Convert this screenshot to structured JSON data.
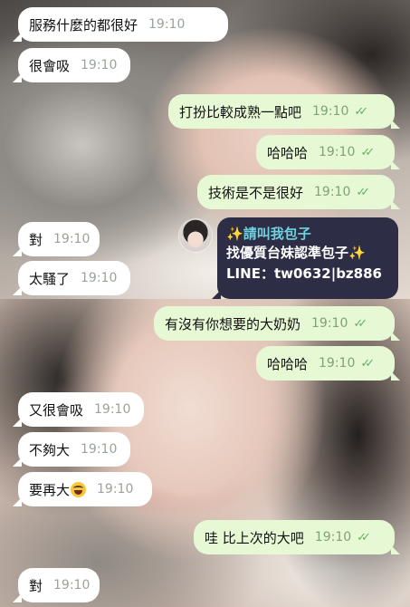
{
  "messages": [
    {
      "text": "服務什麼的都很好",
      "time": "19:10"
    },
    {
      "text": "很會吸",
      "time": "19:10"
    },
    {
      "text": "打扮比較成熟一點吧",
      "time": "19:10"
    },
    {
      "text": "哈哈哈",
      "time": "19:10"
    },
    {
      "text": "技術是不是很好",
      "time": "19:10"
    },
    {
      "text": "對",
      "time": "19:10"
    },
    {
      "text": "太騷了",
      "time": "19:10"
    },
    {
      "text": "有沒有你想要的大奶奶",
      "time": "19:10"
    },
    {
      "text": "哈哈哈",
      "time": "19:10"
    },
    {
      "text": "又很會吸",
      "time": "19:10"
    },
    {
      "text": "不夠大",
      "time": "19:10"
    },
    {
      "text": "要再大",
      "time": "19:10"
    },
    {
      "text": "哇 比上次的大吧",
      "time": "19:10"
    },
    {
      "text": "對",
      "time": "19:10"
    }
  ],
  "ad": {
    "title": "請叫我包子",
    "line1": "找優質台妹認準包子",
    "line2": "LINE：tw0632|bz886"
  },
  "glyphs": {
    "read_ticks": "✓✓",
    "sparkle": "✨"
  },
  "colors": {
    "incoming_bubble": "#ffffff",
    "outgoing_bubble": "#e7f8d5",
    "ad_card": "#2d2d45",
    "ad_title": "#6ed3df",
    "read_ticks": "#68b265"
  },
  "icons": [
    "read-ticks-icon",
    "sparkle-icon",
    "laughing-emoji-icon",
    "avatar"
  ]
}
